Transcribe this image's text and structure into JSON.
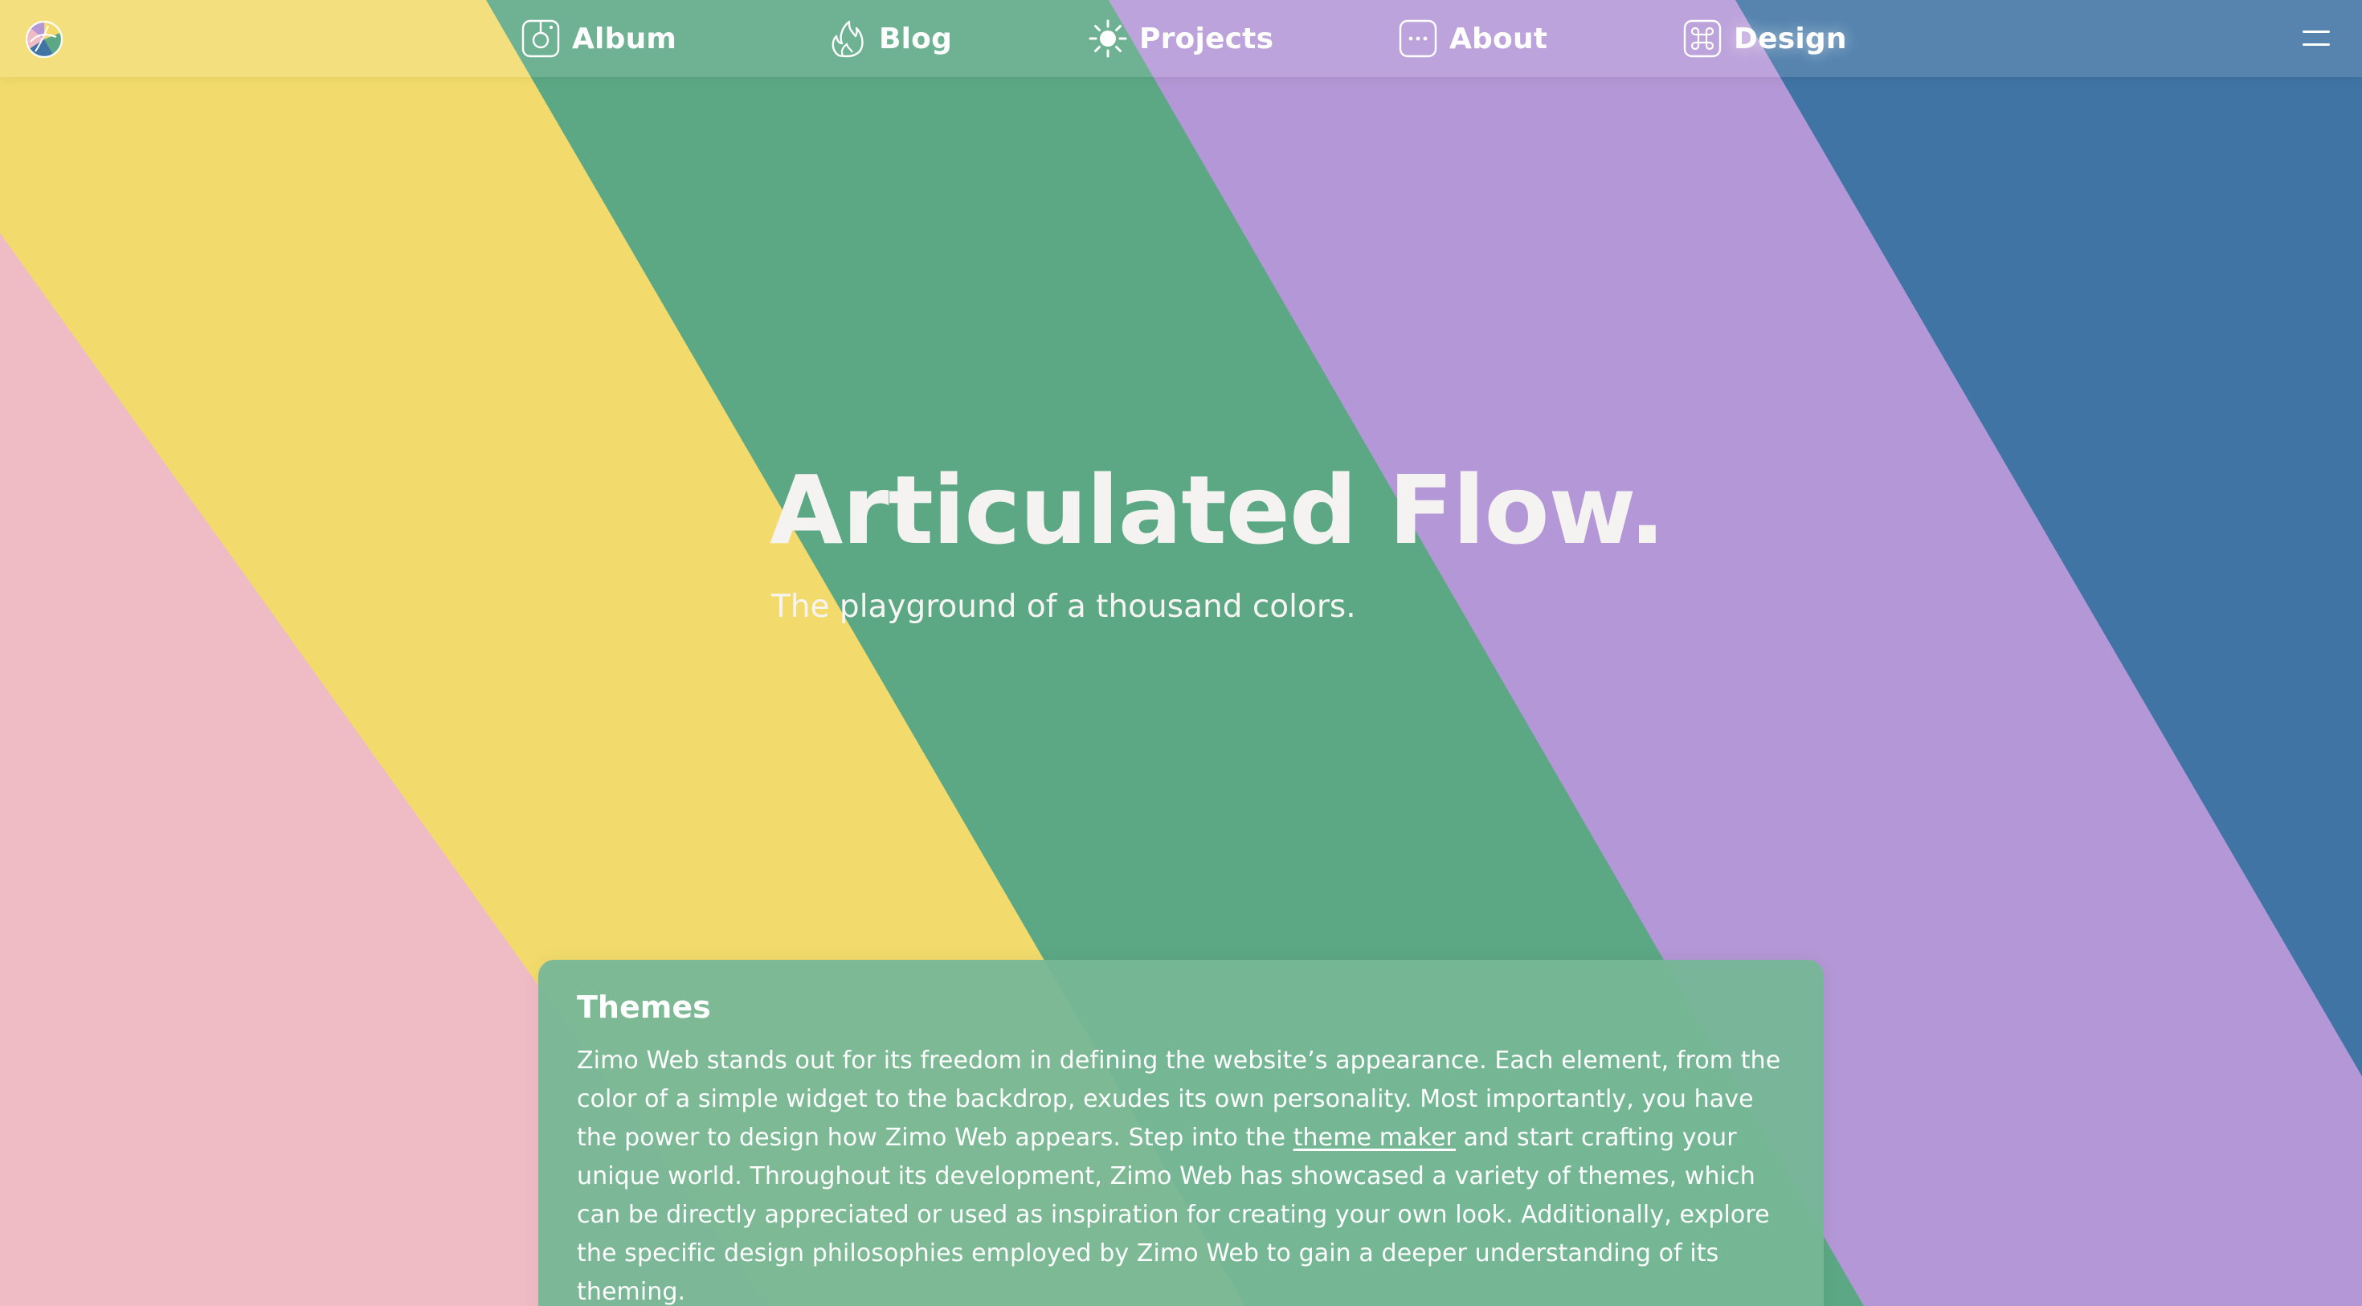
{
  "theme": {
    "stripe_colors": [
      "#efbcc6",
      "#f2db6c",
      "#5ca885",
      "#b497d6",
      "#3f74a4"
    ],
    "text_color": "#ffffff",
    "card_color": "#77b796"
  },
  "header": {
    "logo_icon": "color-wheel-logo-icon",
    "nav_items": [
      {
        "label": "Album",
        "icon": "camera-icon"
      },
      {
        "label": "Blog",
        "icon": "flame-icon"
      },
      {
        "label": "Projects",
        "icon": "sun-icon"
      },
      {
        "label": "About",
        "icon": "ellipsis-box-icon"
      },
      {
        "label": "Design",
        "icon": "command-key-icon"
      }
    ],
    "menu_icon": "hamburger-menu-icon"
  },
  "hero": {
    "title": "Articulated Flow.",
    "subtitle": "The playground of a thousand colors."
  },
  "themes_card": {
    "title": "Themes",
    "body_before_link": "Zimo Web stands out for its freedom in defining the website’s appearance. Each element, from the color of a simple widget to the backdrop, exudes its own personality. Most importantly, you have the power to design how Zimo Web appears. Step into the ",
    "link_text": "theme maker",
    "body_after_link": " and start crafting your unique world. Throughout its development, Zimo Web has showcased a variety of themes, which can be directly appreciated or used as inspiration for creating your own look. Additionally, explore the specific design philosophies employed by Zimo Web to gain a deeper understanding of its theming."
  }
}
